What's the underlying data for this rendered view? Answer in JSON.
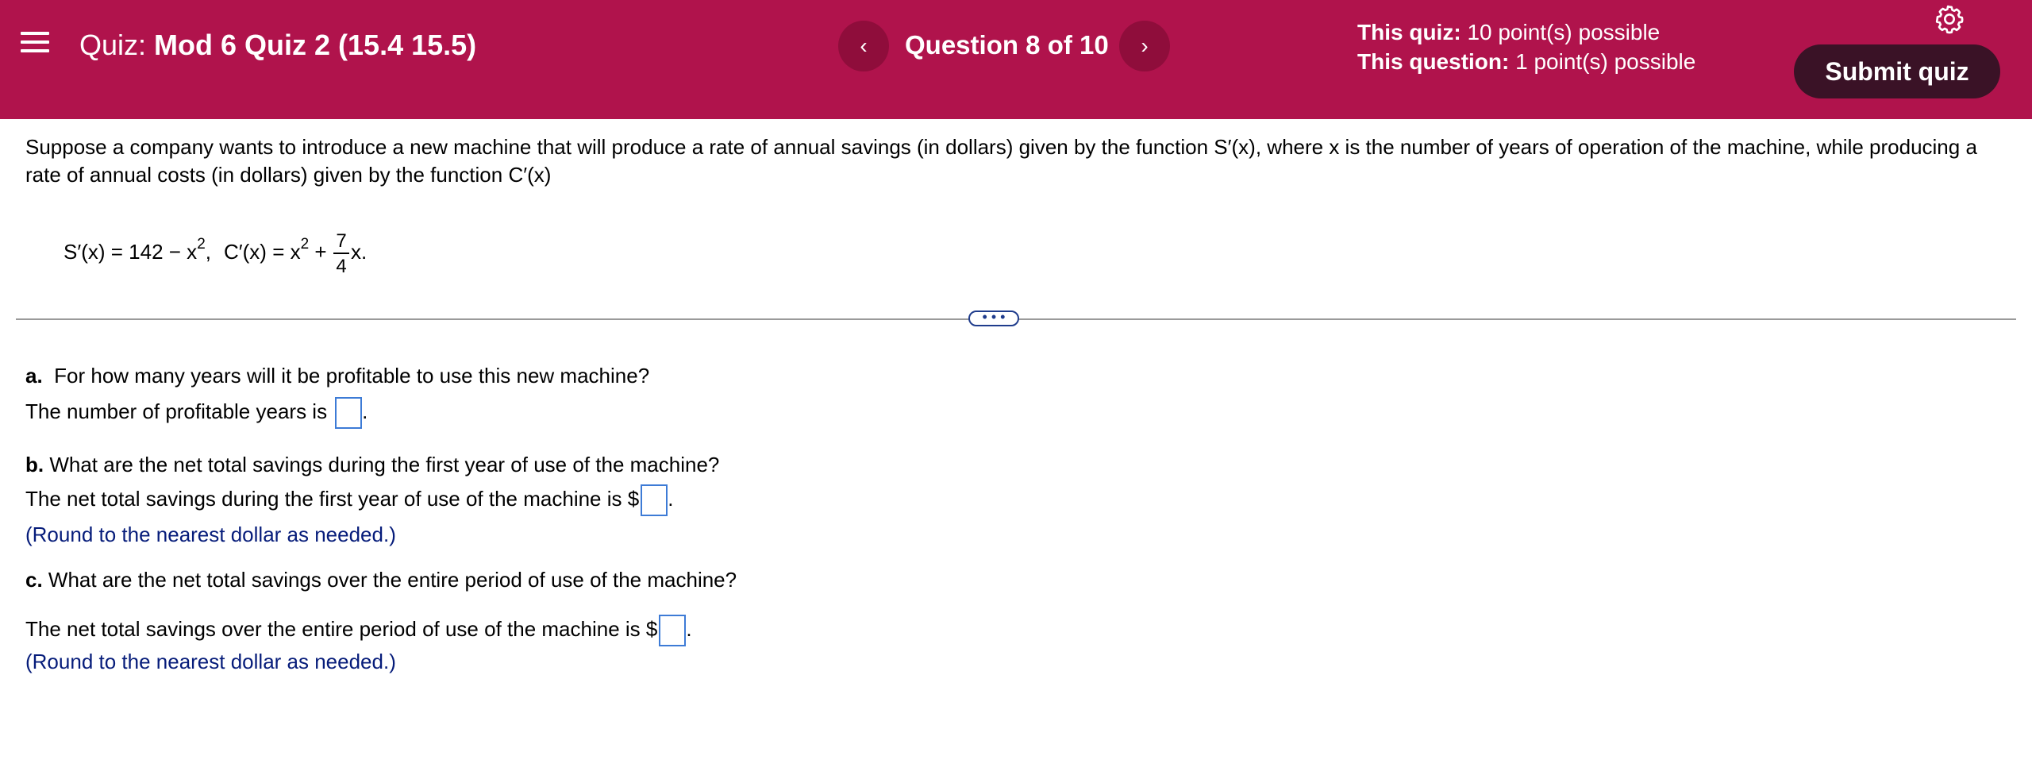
{
  "header": {
    "quiz_label": "Quiz:",
    "quiz_name": "Mod 6 Quiz 2 (15.4 15.5)",
    "prev_glyph": "‹",
    "next_glyph": "›",
    "question_counter": "Question 8 of 10",
    "quiz_points_label": "This quiz:",
    "quiz_points_value": "10 point(s) possible",
    "question_points_label": "This question:",
    "question_points_value": "1 point(s) possible",
    "submit_label": "Submit quiz",
    "colors": {
      "bar": "#b0134c",
      "nav": "#8f0d3b",
      "submit": "#3a1226"
    }
  },
  "icons": [
    "menu-icon",
    "chevron-left-icon",
    "chevron-right-icon",
    "gear-icon"
  ],
  "question": {
    "intro": "Suppose a company wants to introduce a new machine that will produce a rate of annual savings (in dollars) given by the function S′(x), where x is the number of years of operation of the machine, while producing a rate of annual costs (in dollars) given by the function C′(x)",
    "formula": {
      "s_part": "S′(x) = 142 − x",
      "s_exp": "2",
      "comma": ",",
      "c_part": "C′(x) = x",
      "c_exp": "2",
      "plus": "+",
      "frac_num": "7",
      "frac_den": "4",
      "tail": "x."
    },
    "expand_label": "• • •"
  },
  "parts": {
    "a": {
      "letter": "a.",
      "question": "For how many years will it be profitable to use this new machine?",
      "answer_prefix": "The number of profitable years is",
      "answer_suffix": "."
    },
    "b": {
      "letter": "b.",
      "question": "What are the net total savings during the first year of use of the machine?",
      "answer_prefix": "The net total savings during the first year of use of the machine is $",
      "answer_suffix": ".",
      "hint": "(Round to the nearest dollar as needed.)"
    },
    "c": {
      "letter": "c.",
      "question": "What are the net total savings over the entire period of use of the machine?",
      "answer_prefix": "The net total savings over the entire period of use of the machine is $",
      "answer_suffix": ".",
      "hint": "(Round to the nearest dollar as needed.)"
    }
  }
}
